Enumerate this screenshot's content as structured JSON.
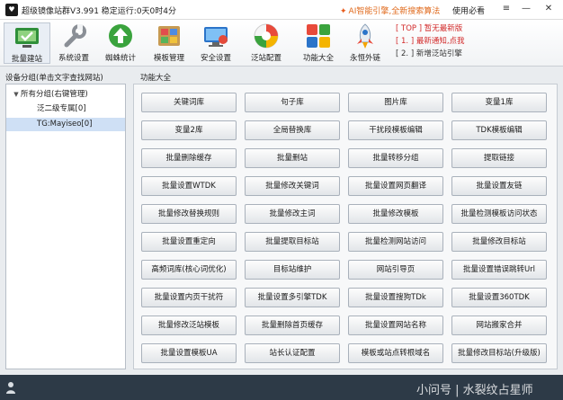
{
  "window": {
    "logo": "♥",
    "title": "超级镜像站群V3.991 稳定运行:0天0时4分",
    "ai_notice": "AI智能引擎,全新搜索算法",
    "help_link": "使用必看",
    "controls": {
      "menu": "≡",
      "minimize": "—",
      "close": "✕"
    }
  },
  "toolbar": {
    "items": [
      {
        "label": "批量建站",
        "icon": "batch-build-icon"
      },
      {
        "label": "系统设置",
        "icon": "wrench-icon"
      },
      {
        "label": "蜘蛛统计",
        "icon": "upload-arrow-icon"
      },
      {
        "label": "模板管理",
        "icon": "template-icon"
      },
      {
        "label": "安全设置",
        "icon": "monitor-security-icon"
      },
      {
        "label": "泛站配置",
        "icon": "colorful-globe-icon"
      },
      {
        "label": "功能大全",
        "icon": "tiles-icon"
      },
      {
        "label": "永恒外链",
        "icon": "rocket-icon"
      }
    ],
    "news": [
      "[ TOP ] 暂无最新版",
      "[ 1. ] 最新通知,点我",
      "[ 2. ] 新增泛站引擎"
    ]
  },
  "left": {
    "title": "设备分组(单击文字查找网站)",
    "tree": {
      "root_toggle": "▼",
      "root": "所有分组(右键管理)",
      "children": [
        "泛二级专属[0]",
        "TG:Mayiseo[0]"
      ]
    }
  },
  "right": {
    "title": "功能大全",
    "buttons": [
      "关键词库",
      "句子库",
      "图片库",
      "变量1库",
      "变量2库",
      "全局替换库",
      "干扰段模板编辑",
      "TDK模板编辑",
      "批量删除缓存",
      "批量删站",
      "批量转移分组",
      "提取链接",
      "批量设置WTDK",
      "批量修改关键词",
      "批量设置网页翻译",
      "批量设置友链",
      "批量修改替换规则",
      "批量修改主词",
      "批量修改模板",
      "批量检测模板访问状态",
      "批量设置重定向",
      "批量提取目标站",
      "批量检测网站访问",
      "批量修改目标站",
      "高频词库(核心词优化)",
      "目标站维护",
      "网站引导页",
      "批量设置错误跳转Url",
      "批量设置内页干扰符",
      "批量设置多引擎TDK",
      "批量设置搜狗TDk",
      "批量设置360TDK",
      "批量修改泛站模板",
      "批量删除首页缓存",
      "批量设置网站名称",
      "网站搬家合并",
      "批量设置模板UA",
      "站长认证配置",
      "模板或站点转根域名",
      "批量修改目标站(升级版)"
    ]
  },
  "statusbar": {
    "watermark": "小问号 | 水裂纹占星师"
  },
  "colors": {
    "accent_red": "#d22a2a",
    "ai_orange": "#e06a1c",
    "statusbar": "#2d3a47",
    "selection": "#cfe0f5"
  }
}
